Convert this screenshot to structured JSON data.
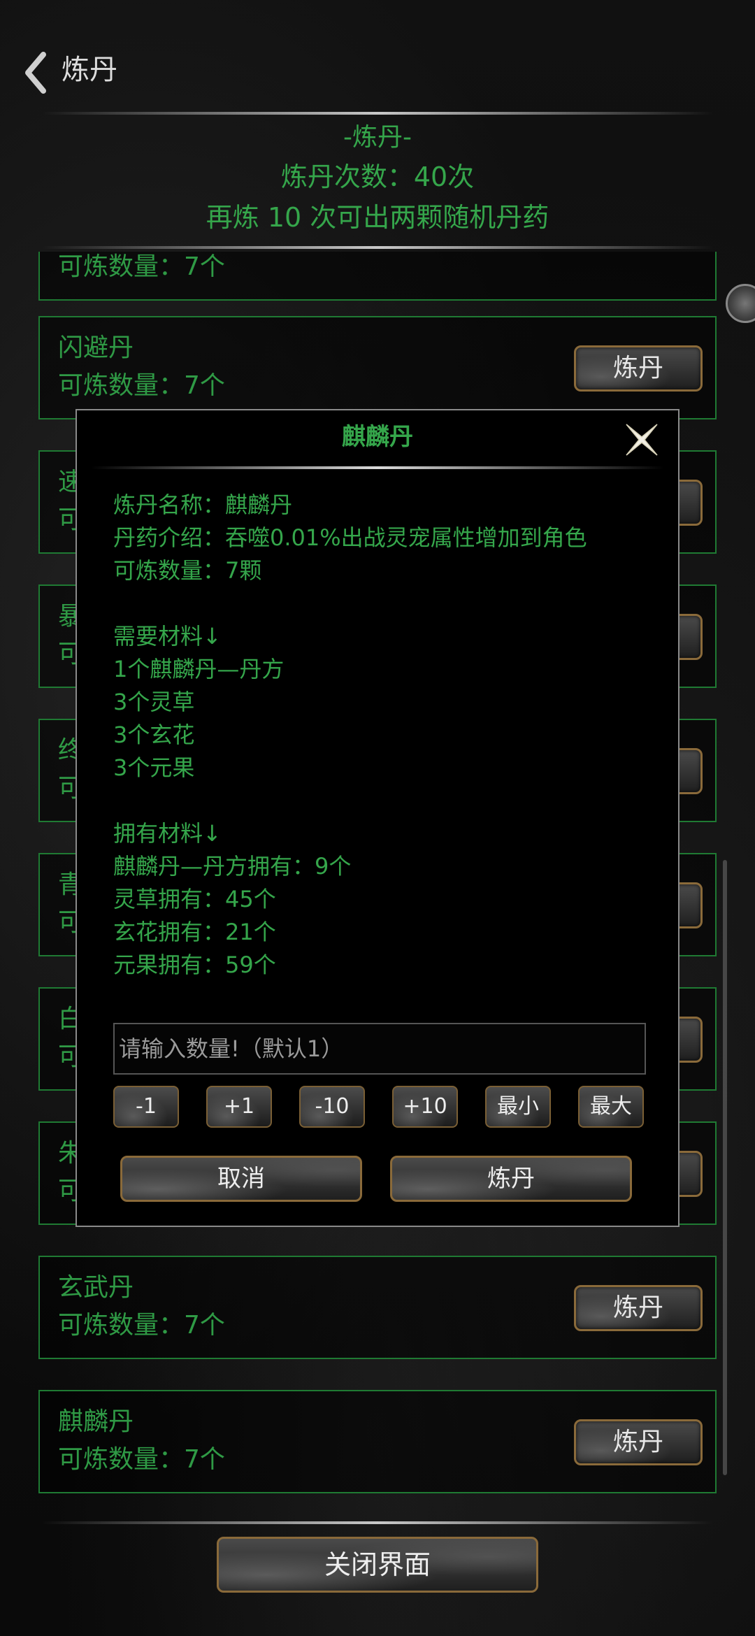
{
  "topbar": {
    "title": "炼丹"
  },
  "header": {
    "section_title": "-炼丹-",
    "count_line": "炼丹次数：40次",
    "hint_line": "再炼 10 次可出两颗随机丹药"
  },
  "list": {
    "partial_top_text": "可炼数量：7个",
    "items": [
      {
        "name": "闪避丹",
        "count": "可炼数量：7个",
        "button": "炼丹"
      },
      {
        "name": "速",
        "count": "可",
        "button": "炼丹"
      },
      {
        "name": "暴",
        "count": "可",
        "button": "炼丹"
      },
      {
        "name": "终",
        "count": "可",
        "button": "炼丹"
      },
      {
        "name": "青",
        "count": "可",
        "button": "炼丹"
      },
      {
        "name": "白",
        "count": "可",
        "button": "炼丹"
      },
      {
        "name": "朱",
        "count": "可",
        "button": "炼丹"
      },
      {
        "name": "玄武丹",
        "count": "可炼数量：7个",
        "button": "炼丹"
      },
      {
        "name": "麒麟丹",
        "count": "可炼数量：7个",
        "button": "炼丹"
      }
    ]
  },
  "modal": {
    "title": "麒麟丹",
    "lines": [
      "炼丹名称：麒麟丹",
      "丹药介绍：吞噬0.01%出战灵宠属性增加到角色",
      "可炼数量：7颗",
      "",
      "需要材料↓",
      "1个麒麟丹—丹方",
      "3个灵草",
      "3个玄花",
      "3个元果",
      "",
      "拥有材料↓",
      "麒麟丹—丹方拥有：9个",
      "灵草拥有：45个",
      "玄花拥有：21个",
      "元果拥有：59个"
    ],
    "input_placeholder": "请输入数量!（默认1）",
    "step_buttons": [
      "-1",
      "+1",
      "-10",
      "+10",
      "最小",
      "最大"
    ],
    "cancel_label": "取消",
    "confirm_label": "炼丹"
  },
  "footer": {
    "close_label": "关闭界面"
  },
  "colors": {
    "green_text": "#35a64b",
    "item_border": "#1f7a33",
    "button_border": "#8a6a3a"
  }
}
